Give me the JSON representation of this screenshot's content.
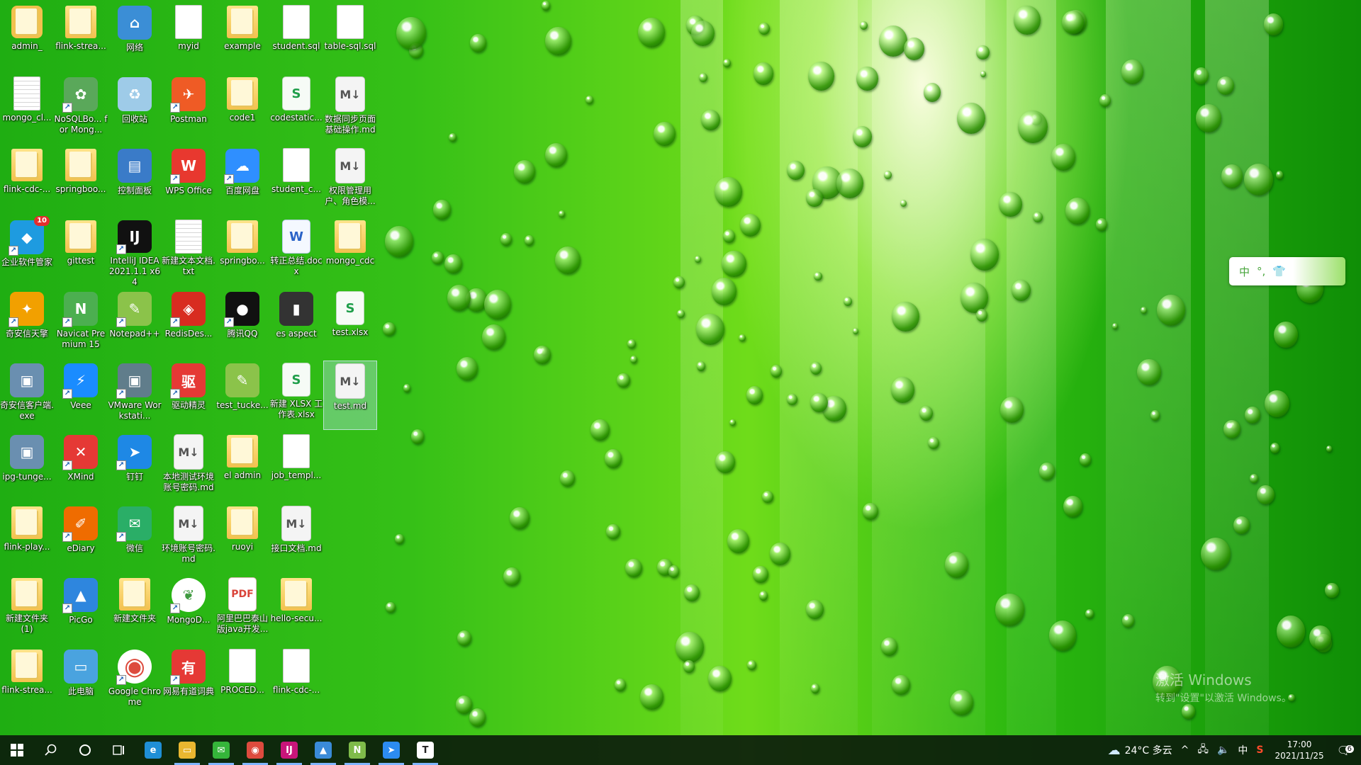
{
  "desktop": {
    "icons": [
      {
        "label": "admin_",
        "type": "user-folder-icon",
        "shortcut": false
      },
      {
        "label": "flink-strea...",
        "type": "folder-icon",
        "shortcut": false
      },
      {
        "label": "网络",
        "type": "network-icon",
        "shortcut": false
      },
      {
        "label": "myid",
        "type": "file-icon",
        "shortcut": false
      },
      {
        "label": "example",
        "type": "folder-icon",
        "shortcut": false
      },
      {
        "label": "student.sql",
        "type": "file-icon",
        "shortcut": false
      },
      {
        "label": "table-sql.sql",
        "type": "file-icon",
        "shortcut": false
      },
      {
        "label": "mongo_cl...",
        "type": "text-file-icon",
        "shortcut": false
      },
      {
        "label": "NoSQLBo... for Mong...",
        "type": "nosqlbooster-icon",
        "shortcut": true
      },
      {
        "label": "回收站",
        "type": "recycle-bin-icon",
        "shortcut": false
      },
      {
        "label": "Postman",
        "type": "postman-icon",
        "shortcut": true
      },
      {
        "label": "code1",
        "type": "folder-icon",
        "shortcut": false
      },
      {
        "label": "codestatic...",
        "type": "spreadsheet-icon",
        "shortcut": false
      },
      {
        "label": "数据同步页面基础操作.md",
        "type": "markdown-icon",
        "shortcut": false
      },
      {
        "label": "flink-cdc-...",
        "type": "folder-icon",
        "shortcut": false
      },
      {
        "label": "springboo...",
        "type": "folder-icon",
        "shortcut": false
      },
      {
        "label": "控制面板",
        "type": "control-panel-icon",
        "shortcut": false
      },
      {
        "label": "WPS Office",
        "type": "wps-icon",
        "shortcut": true
      },
      {
        "label": "百度网盘",
        "type": "baidu-netdisk-icon",
        "shortcut": true
      },
      {
        "label": "student_c...",
        "type": "file-icon",
        "shortcut": false
      },
      {
        "label": "权限管理用户、角色模...",
        "type": "markdown-icon",
        "shortcut": false
      },
      {
        "label": "企业软件管家",
        "type": "software-manager-icon",
        "shortcut": true,
        "badge": "10"
      },
      {
        "label": "gittest",
        "type": "folder-icon",
        "shortcut": false
      },
      {
        "label": "IntelliJ IDEA 2021.1.1 x64",
        "type": "intellij-icon",
        "shortcut": true
      },
      {
        "label": "新建文本文档.txt",
        "type": "text-file-icon",
        "shortcut": false
      },
      {
        "label": "springbo...",
        "type": "folder-icon",
        "shortcut": false
      },
      {
        "label": "转正总结.docx",
        "type": "word-doc-icon",
        "shortcut": false
      },
      {
        "label": "mongo_cdc",
        "type": "folder-icon",
        "shortcut": false
      },
      {
        "label": "奇安信天擎",
        "type": "qianxin-icon",
        "shortcut": true
      },
      {
        "label": "Navicat Premium 15",
        "type": "navicat-icon",
        "shortcut": true
      },
      {
        "label": "Notepad++",
        "type": "notepadpp-icon",
        "shortcut": true
      },
      {
        "label": "RedisDes...",
        "type": "redis-icon",
        "shortcut": true
      },
      {
        "label": "腾讯QQ",
        "type": "qq-icon",
        "shortcut": true
      },
      {
        "label": "es aspect",
        "type": "dark-folder-icon",
        "shortcut": false
      },
      {
        "label": "test.xlsx",
        "type": "spreadsheet-icon",
        "shortcut": false
      },
      {
        "label": "奇安信客户端.exe",
        "type": "installer-icon",
        "shortcut": false
      },
      {
        "label": "Veee",
        "type": "veee-icon",
        "shortcut": true
      },
      {
        "label": "VMware Workstati...",
        "type": "vmware-icon",
        "shortcut": true
      },
      {
        "label": "驱动精灵",
        "type": "driver-genius-icon",
        "shortcut": true
      },
      {
        "label": "test_tucke...",
        "type": "notepadpp-icon",
        "shortcut": false
      },
      {
        "label": "新建 XLSX 工作表.xlsx",
        "type": "spreadsheet-icon",
        "shortcut": false
      },
      {
        "label": "test.md",
        "type": "markdown-icon",
        "shortcut": false,
        "selected": true
      },
      {
        "label": "ipg-tunge...",
        "type": "installer-icon",
        "shortcut": false
      },
      {
        "label": "XMind",
        "type": "xmind-icon",
        "shortcut": true
      },
      {
        "label": "钉钉",
        "type": "dingtalk-icon",
        "shortcut": true
      },
      {
        "label": "本地测试环境账号密码.md",
        "type": "markdown-icon",
        "shortcut": false
      },
      {
        "label": "el admin",
        "type": "folder-icon",
        "shortcut": false
      },
      {
        "label": "job_templ...",
        "type": "file-icon",
        "shortcut": false
      },
      null,
      {
        "label": "flink-play...",
        "type": "folder-icon",
        "shortcut": false
      },
      {
        "label": "eDiary",
        "type": "ediary-icon",
        "shortcut": true
      },
      {
        "label": "微信",
        "type": "wechat-icon",
        "shortcut": true
      },
      {
        "label": "环境账号密码.md",
        "type": "markdown-icon",
        "shortcut": false
      },
      {
        "label": "ruoyi",
        "type": "folder-icon",
        "shortcut": false
      },
      {
        "label": "接口文档.md",
        "type": "markdown-icon",
        "shortcut": false
      },
      null,
      {
        "label": "新建文件夹(1)",
        "type": "folder-icon",
        "shortcut": false
      },
      {
        "label": "PicGo",
        "type": "picgo-icon",
        "shortcut": true
      },
      {
        "label": "新建文件夹",
        "type": "folder-icon",
        "shortcut": false
      },
      {
        "label": "MongoD...",
        "type": "mongodb-icon",
        "shortcut": true
      },
      {
        "label": "阿里巴巴泰山版java开发...",
        "type": "pdf-icon",
        "shortcut": false
      },
      {
        "label": "hello-secu...",
        "type": "folder-icon",
        "shortcut": false
      },
      null,
      {
        "label": "flink-strea...",
        "type": "folder-icon",
        "shortcut": false
      },
      {
        "label": "此电脑",
        "type": "this-pc-icon",
        "shortcut": false
      },
      {
        "label": "Google Chrome",
        "type": "chrome-icon",
        "shortcut": true
      },
      {
        "label": "网易有道词典",
        "type": "youdao-icon",
        "shortcut": true
      },
      {
        "label": "PROCED...",
        "type": "file-icon",
        "shortcut": false
      },
      {
        "label": "flink-cdc-...",
        "type": "file-icon",
        "shortcut": false
      },
      null
    ]
  },
  "ime": {
    "lang": "中",
    "punct": "°,",
    "skin": "shirt-icon"
  },
  "watermark": {
    "line1": "激活 Windows",
    "line2": "转到\"设置\"以激活 Windows。"
  },
  "taskbar": {
    "start": "windows-start-icon",
    "search": "search-icon",
    "cortana": "cortana-icon",
    "taskview": "task-view-icon",
    "apps": [
      {
        "name": "edge-icon",
        "color": "#1f8fd6",
        "glyph": "e",
        "running": false
      },
      {
        "name": "file-explorer-icon",
        "color": "#e9b730",
        "glyph": "▭",
        "running": true
      },
      {
        "name": "wechat-icon",
        "color": "#35b53a",
        "glyph": "✉",
        "running": true
      },
      {
        "name": "chrome-icon",
        "color": "#dd4b3e",
        "glyph": "◉",
        "running": true
      },
      {
        "name": "intellij-icon",
        "color": "#c8157a",
        "glyph": "IJ",
        "running": true
      },
      {
        "name": "picgo-icon",
        "color": "#3a8bd8",
        "glyph": "▲",
        "running": true
      },
      {
        "name": "notepadpp-icon",
        "color": "#7fbb4a",
        "glyph": "N",
        "running": true
      },
      {
        "name": "dingtalk-icon",
        "color": "#2c8cf0",
        "glyph": "➤",
        "running": true
      },
      {
        "name": "typora-icon",
        "color": "#ffffff",
        "glyph": "T",
        "running": true
      }
    ],
    "tray": {
      "weather": "24°C 多云",
      "weather_icon": "cloud-icon",
      "ime_lang": "中",
      "time": "17:00",
      "date": "2021/11/25",
      "notifications": "6"
    }
  }
}
